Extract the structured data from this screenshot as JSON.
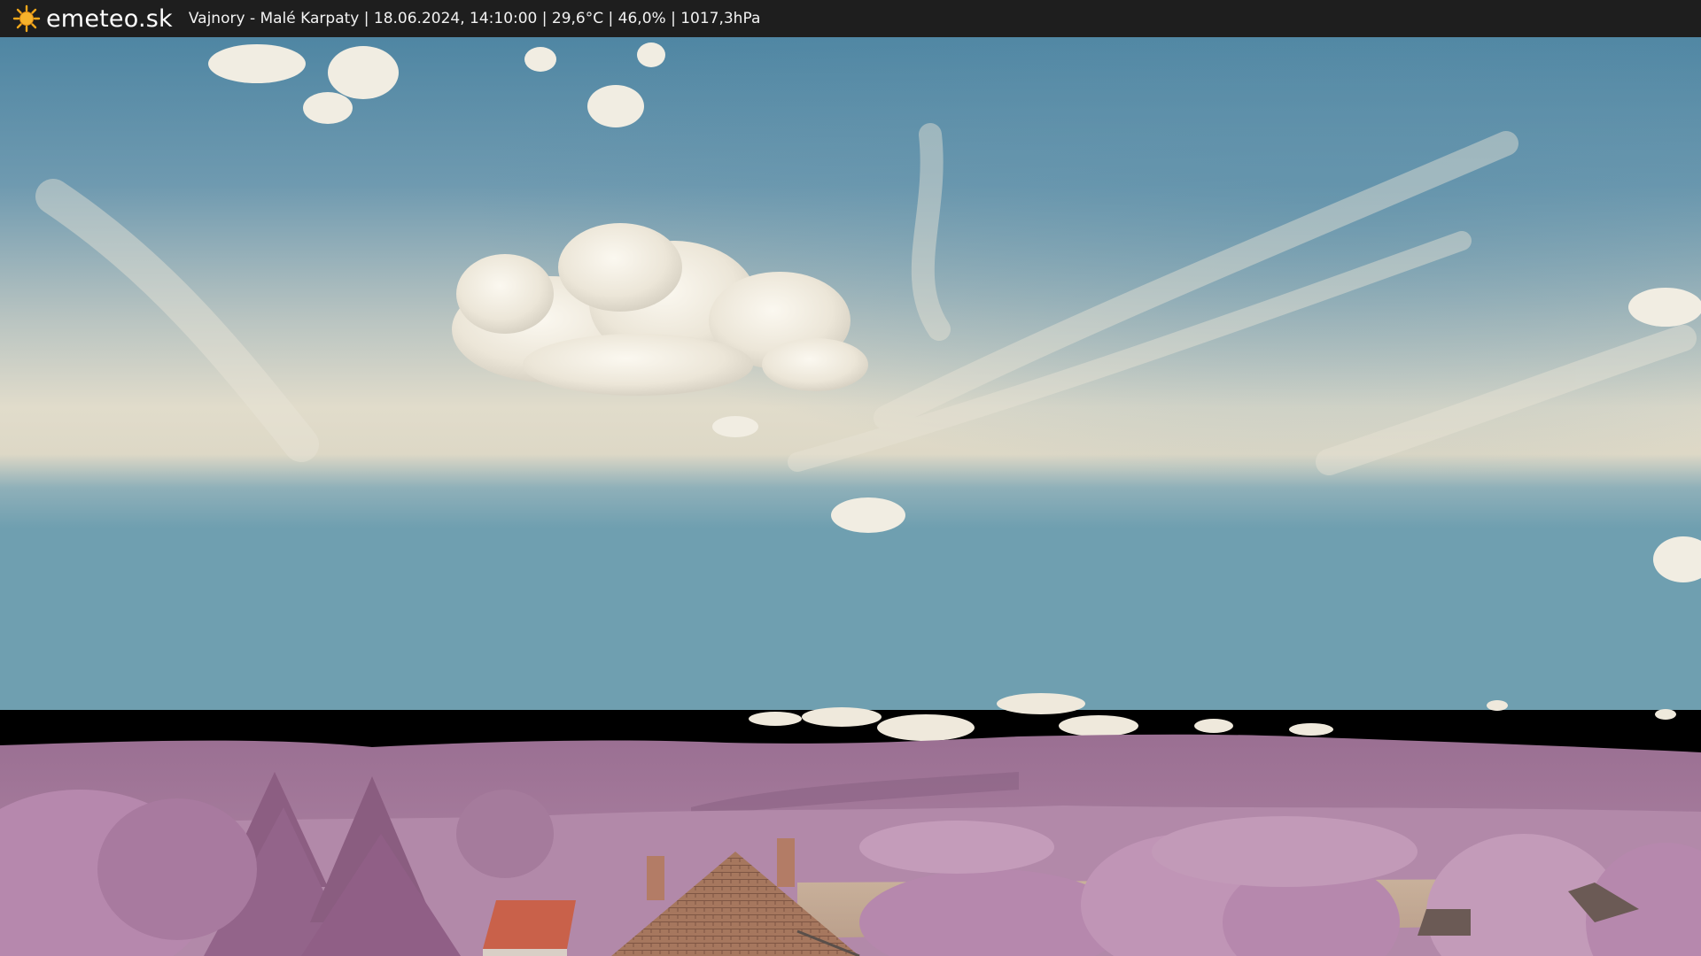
{
  "header": {
    "brand": "emeteo.sk",
    "caption": "Vajnory - Malé Karpaty | 18.06.2024, 14:10:00 | 29,6°C | 46,0% | 1017,3hPa",
    "icon": "sun-icon"
  },
  "colors": {
    "bar": "#1e1e1e",
    "sky_top": "#5a8da8",
    "sky_haze": "#e2ddcc",
    "hills": "#a27b9a",
    "trees": "#b88aae",
    "roof": "#c9614a",
    "field": "#c6ab95"
  }
}
